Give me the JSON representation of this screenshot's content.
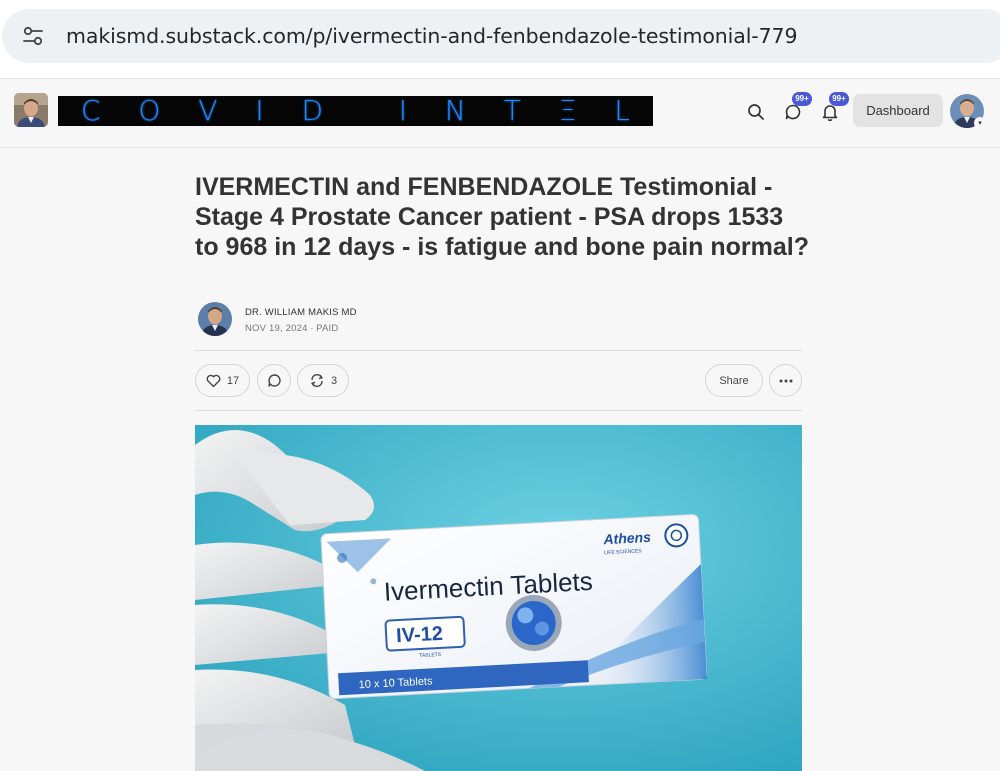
{
  "browser": {
    "url": "makismd.substack.com/p/ivermectin-and-fenbendazole-testimonial-779",
    "site_settings_icon": "tune-icon"
  },
  "header": {
    "banner_letters": [
      "C",
      "O",
      "V",
      "I",
      "D",
      "",
      "I",
      "N",
      "T",
      "Ξ",
      "L"
    ],
    "chat_badge": "99+",
    "notif_badge": "99+",
    "dashboard_label": "Dashboard",
    "icons": [
      "search-icon",
      "chat-icon",
      "bell-icon",
      "avatar",
      "chevron-down-icon"
    ],
    "banner_color": "#1e88ff"
  },
  "post": {
    "title": "IVERMECTIN and FENBENDAZOLE Testimonial - Stage 4 Prostate Cancer patient - PSA drops 1533 to 968 in 12 days - is fatigue and bone pain normal?",
    "author": "DR. WILLIAM MAKIS MD",
    "meta": "NOV 19, 2024 ∙ PAID",
    "likes": "17",
    "restacks": "3",
    "share_label": "Share"
  },
  "photo": {
    "box_brand": "Athens",
    "box_brand_sub": "LIFE SCIENCES",
    "box_title": "Ivermectin Tablets",
    "box_code": "IV-12",
    "box_code_sub": "TABLETS",
    "box_count": "10 x 10 Tablets"
  }
}
